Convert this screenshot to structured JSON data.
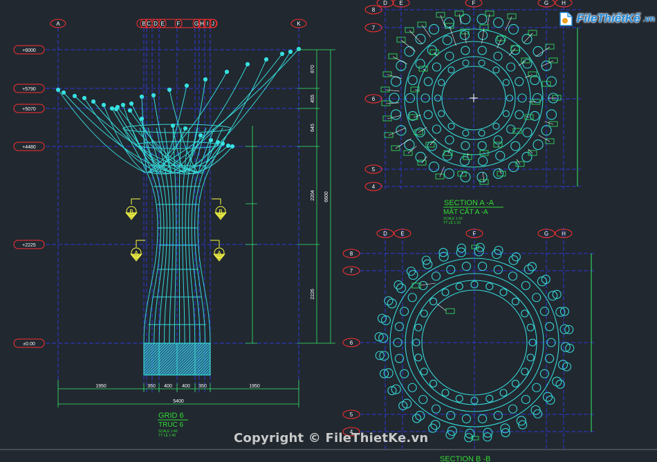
{
  "watermark": {
    "logo_text": "FileThiếtKế",
    "logo_tld": ".vn",
    "copyright": "Copyright © FileThietKe.vn"
  },
  "elevation": {
    "grid_labels": [
      "A",
      "B",
      "C",
      "D",
      "E",
      "F",
      "G",
      "H",
      "I",
      "J",
      "K"
    ],
    "level_labels": [
      "+6000",
      "+5790",
      "+5070",
      "+4480",
      "+2225",
      "±0.00"
    ],
    "bottom_dims": [
      "1950",
      "350",
      "400",
      "400",
      "350",
      "1950"
    ],
    "total_dim": "5400",
    "right_dims": [
      "870",
      "455",
      "645",
      "2204",
      "2226"
    ],
    "overall_dim": "6600",
    "section_marks": [
      "B",
      "B",
      "A",
      "A"
    ],
    "title": "GRID 6",
    "subtitle": "TRUC 6",
    "scale_1": "SCALE 1:40",
    "scale_2": "TỶ LỆ 1:40"
  },
  "section_a": {
    "grid_top": [
      "D",
      "E",
      "F",
      "G",
      "H"
    ],
    "grid_left": [
      "8",
      "7",
      "6",
      "5",
      "4"
    ],
    "title": "SECTION A -A",
    "subtitle": "MẶT CẮT A -A",
    "scale_1": "SCALE 1:10",
    "scale_2": "TỶ LỆ 1:10"
  },
  "section_b": {
    "grid_top": [
      "D",
      "E",
      "F",
      "G",
      "H"
    ],
    "grid_left": [
      "8",
      "7",
      "6",
      "5",
      "4"
    ],
    "title": "SECTION B -B"
  },
  "colors": {
    "background": "#212830",
    "structure": "#37d8d8",
    "grid_line": "#2e39d8",
    "grid_bubble": "#ff3030",
    "text": "#ffff44",
    "title": "#33dd33",
    "dim": "#33ee66"
  }
}
